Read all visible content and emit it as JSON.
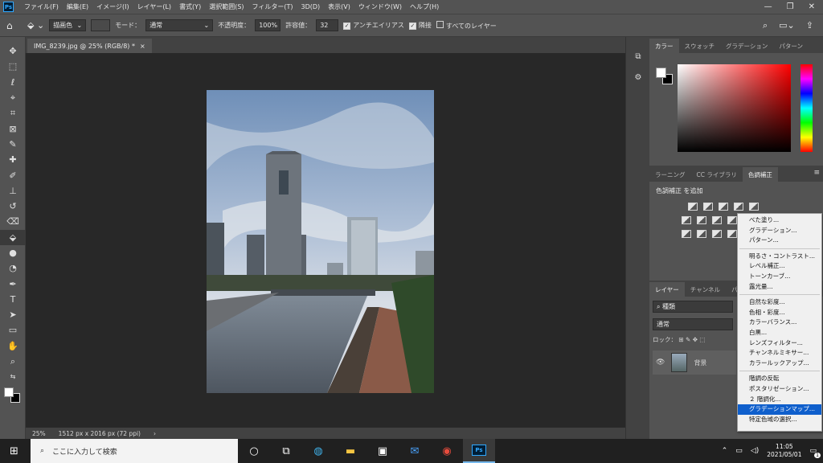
{
  "app": {
    "logo": "Ps"
  },
  "menu": [
    "ファイル(F)",
    "編集(E)",
    "イメージ(I)",
    "レイヤー(L)",
    "書式(Y)",
    "選択範囲(S)",
    "フィルター(T)",
    "3D(D)",
    "表示(V)",
    "ウィンドウ(W)",
    "ヘルプ(H)"
  ],
  "window_controls": {
    "minimize": "—",
    "maximize": "❐",
    "close": "✕"
  },
  "options": {
    "fill_source": "描画色",
    "mode_label": "モード：",
    "mode_value": "通常",
    "opacity_label": "不透明度：",
    "opacity_value": "100%",
    "tolerance_label": "許容値：",
    "tolerance_value": "32",
    "antialias_label": "アンチエイリアス",
    "antialias_checked": true,
    "contiguous_label": "隣接",
    "contiguous_checked": true,
    "all_layers_label": "すべてのレイヤー",
    "all_layers_checked": false
  },
  "document": {
    "tab_title": "IMG_8239.jpg @ 25% (RGB/8) *",
    "close": "×"
  },
  "status": {
    "zoom": "25%",
    "info": "1512 px x 2016 px (72 ppi)",
    "arrow": "›"
  },
  "panels": {
    "color_tabs": [
      "カラー",
      "スウォッチ",
      "グラデーション",
      "パターン"
    ],
    "adjust_tabs": [
      "ラーニング",
      "CC ライブラリ",
      "色調補正"
    ],
    "adjust_title": "色調補正 を追加",
    "layer_tabs": [
      "レイヤー",
      "チャンネル",
      "パス"
    ],
    "layer_kind": "種類",
    "blend_mode": "通常",
    "lock_label": "ロック：",
    "layer_name": "背景"
  },
  "context_menu": {
    "groups": [
      [
        "べた塗り...",
        "グラデーション...",
        "パターン..."
      ],
      [
        "明るさ・コントラスト...",
        "レベル補正...",
        "トーンカーブ...",
        "露光量..."
      ],
      [
        "自然な彩度...",
        "色相・彩度...",
        "カラーバランス...",
        "白黒...",
        "レンズフィルター...",
        "チャンネルミキサー...",
        "カラールックアップ..."
      ],
      [
        "階調の反転",
        "ポスタリゼーション...",
        "２ 階調化...",
        "グラデーションマップ...",
        "特定色域の選択..."
      ]
    ],
    "highlighted": "グラデーションマップ..."
  },
  "taskbar": {
    "search_placeholder": "ここに入力して検索",
    "time": "11:05",
    "date": "2021/05/01",
    "notification_count": "1"
  },
  "colors": {
    "ui_bg": "#535353",
    "canvas": "#282828",
    "highlight": "#0f5fcc"
  }
}
